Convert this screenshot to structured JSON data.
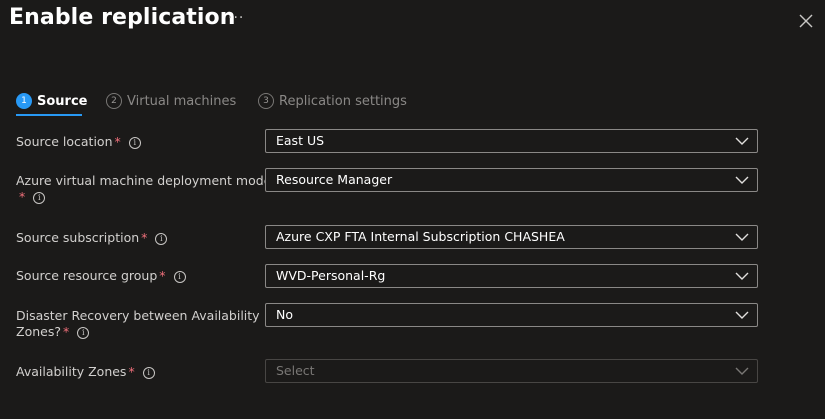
{
  "header": {
    "title": "Enable replication",
    "more_label": "···"
  },
  "steps": [
    {
      "number": "1",
      "label": "Source",
      "active": true
    },
    {
      "number": "2",
      "label": "Virtual machines",
      "active": false
    },
    {
      "number": "3",
      "label": "Replication settings",
      "active": false
    }
  ],
  "form": {
    "source_location": {
      "label": "Source location",
      "required": "*",
      "value": "East US"
    },
    "deployment_model": {
      "label_line1": "Azure virtual machine deployment model",
      "required": "*",
      "value": "Resource Manager"
    },
    "source_subscription": {
      "label": "Source subscription",
      "required": "*",
      "value": "Azure CXP FTA Internal Subscription CHASHEA"
    },
    "source_resource_group": {
      "label": "Source resource group",
      "required": "*",
      "value": "WVD-Personal-Rg"
    },
    "disaster_recovery": {
      "label_line1": "Disaster Recovery between Availability",
      "label_line2": "Zones?",
      "required": "*",
      "value": "No"
    },
    "availability_zones": {
      "label": "Availability Zones",
      "required": "*",
      "placeholder": "Select"
    }
  },
  "info_glyph": "i",
  "colors": {
    "background": "#1b1a19",
    "accent": "#2899f5",
    "required": "#f1707b"
  }
}
